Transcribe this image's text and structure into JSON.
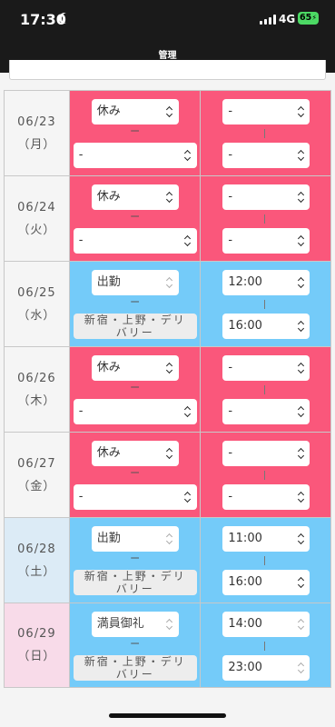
{
  "status_bar": {
    "time": "17:30",
    "network": "4G",
    "battery": "65"
  },
  "header": {
    "title": "管理"
  },
  "days": [
    {
      "date": "06/23",
      "weekday": "（月）",
      "kind": "weekday",
      "status": "休み",
      "status_disabled": false,
      "location": [
        "-"
      ],
      "location_disabled": false,
      "state": "off",
      "start": "-",
      "end": "-",
      "time_disabled": false
    },
    {
      "date": "06/24",
      "weekday": "（火）",
      "kind": "weekday",
      "status": "休み",
      "status_disabled": false,
      "location": [
        "-"
      ],
      "location_disabled": false,
      "state": "off",
      "start": "-",
      "end": "-",
      "time_disabled": false
    },
    {
      "date": "06/25",
      "weekday": "（水）",
      "kind": "weekday",
      "status": "出勤",
      "status_disabled": true,
      "location": [
        "新宿・上野・デリ",
        "バリー"
      ],
      "location_disabled": true,
      "state": "on",
      "start": "12:00",
      "end": "16:00",
      "time_disabled": false
    },
    {
      "date": "06/26",
      "weekday": "（木）",
      "kind": "weekday",
      "status": "休み",
      "status_disabled": false,
      "location": [
        "-"
      ],
      "location_disabled": false,
      "state": "off",
      "start": "-",
      "end": "-",
      "time_disabled": false
    },
    {
      "date": "06/27",
      "weekday": "（金）",
      "kind": "weekday",
      "status": "休み",
      "status_disabled": false,
      "location": [
        "-"
      ],
      "location_disabled": false,
      "state": "off",
      "start": "-",
      "end": "-",
      "time_disabled": false
    },
    {
      "date": "06/28",
      "weekday": "（土）",
      "kind": "sat",
      "status": "出勤",
      "status_disabled": true,
      "location": [
        "新宿・上野・デリ",
        "バリー"
      ],
      "location_disabled": true,
      "state": "on",
      "start": "11:00",
      "end": "16:00",
      "time_disabled": false
    },
    {
      "date": "06/29",
      "weekday": "（日）",
      "kind": "sun",
      "status": "満員御礼",
      "status_disabled": true,
      "location": [
        "新宿・上野・デリ",
        "バリー"
      ],
      "location_disabled": true,
      "state": "on",
      "start": "14:00",
      "end": "23:00",
      "time_disabled": true
    }
  ],
  "separators": {
    "status_location": "ー",
    "time_range": "|"
  },
  "colors": {
    "off": "#fa577b",
    "on": "#74cbf9",
    "saturday": "#dcebf6",
    "sunday": "#f8dbe9"
  }
}
